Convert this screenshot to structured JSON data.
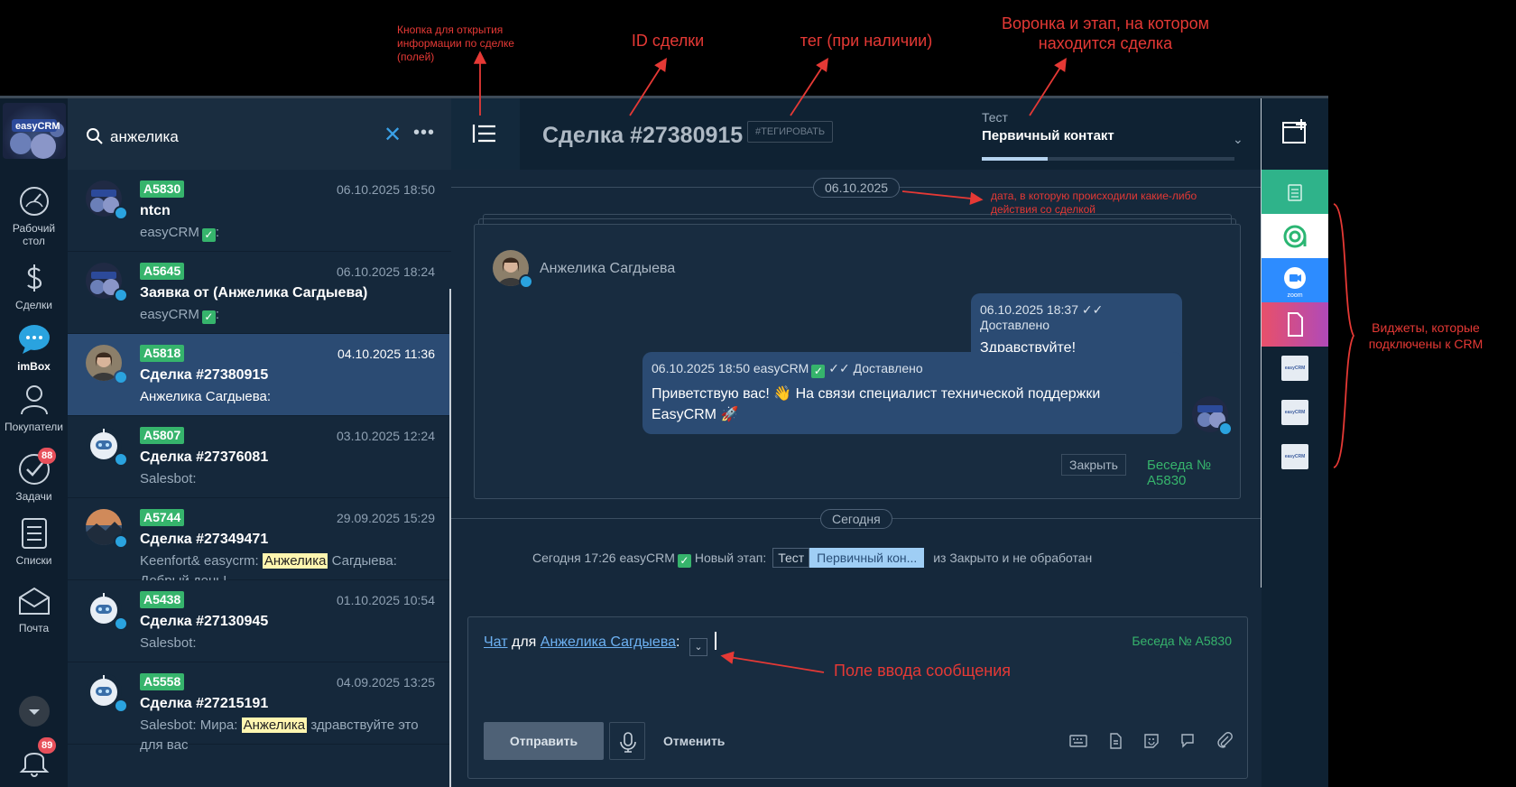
{
  "annotations": {
    "fields_button": "Кнопка для открытия информации по сделке (полей)",
    "deal_id": "ID сделки",
    "tag": "тег (при наличии)",
    "funnel": "Воронка и этап, на котором находится сделка",
    "date": "дата, в которую происходили какие-либо действия со сделкой",
    "widgets": "Виджеты, которые подключены к CRM",
    "input": "Поле ввода сообщения"
  },
  "nav": {
    "logo": "easyCRM",
    "items": [
      {
        "label": "Рабочий стол"
      },
      {
        "label": "Сделки"
      },
      {
        "label": "imBox"
      },
      {
        "label": "Покупатели"
      },
      {
        "label": "Задачи",
        "badge": "88"
      },
      {
        "label": "Списки"
      },
      {
        "label": "Почта"
      },
      {
        "label": "",
        "badge": "89"
      }
    ]
  },
  "search": {
    "query": "анжелика"
  },
  "chats": [
    {
      "code": "A5830",
      "date": "06.10.2025 18:50",
      "title": "ntcn",
      "sub": "easyCRM",
      "sub_suffix": ":"
    },
    {
      "code": "A5645",
      "date": "06.10.2025 18:24",
      "title": "Заявка от (Анжелика Сагдыева)",
      "sub": "easyCRM",
      "sub_suffix": ":"
    },
    {
      "code": "A5818",
      "date": "04.10.2025 11:36",
      "title": "Сделка #27380915",
      "sub": "Анжелика Сагдыева:"
    },
    {
      "code": "A5807",
      "date": "03.10.2025 12:24",
      "title": "Сделка #27376081",
      "sub": "Salesbot:"
    },
    {
      "code": "A5744",
      "date": "29.09.2025 15:29",
      "title": "Сделка #27349471",
      "sub_pre": "Keenfort& easycrm: ",
      "sub_hl": "Анжелика",
      "sub_post": " Сагдыева: Добрый день!"
    },
    {
      "code": "A5438",
      "date": "01.10.2025 10:54",
      "title": "Сделка #27130945",
      "sub": "Salesbot:"
    },
    {
      "code": "A5558",
      "date": "04.09.2025 13:25",
      "title": "Сделка #27215191",
      "sub_pre": "Salesbot: Мира: ",
      "sub_hl": "Анжелика",
      "sub_post": " здравствуйте это для вас"
    }
  ],
  "deal": {
    "title": "Сделка #27380915",
    "tag_button": "#ТЕГИРОВАТЬ",
    "funnel": "Тест",
    "stage": "Первичный контакт",
    "stage_progress": 0.26
  },
  "feed": {
    "date_pill": "06.10.2025",
    "sender": "Анжелика Сагдыева",
    "msg1": {
      "meta_date": "06.10.2025 18:37",
      "status": "Доставлено",
      "text": "Здравствуйте!"
    },
    "msg2": {
      "meta_date": "06.10.2025 18:50 easyCRM",
      "status": "Доставлено",
      "text": "Приветствую вас!  👋  На связи специалист технической поддержки EasyCRM 🚀"
    },
    "close_button": "Закрыть",
    "conversation": "Беседа № A5830",
    "today_pill": "Сегодня",
    "event": {
      "pre": "Сегодня 17:26 easyCRM",
      "label": "Новый этап:",
      "funnel": "Тест",
      "stage": "Первичный кон...",
      "post": "из Закрыто и не обработан"
    }
  },
  "composer": {
    "chat_link": "Чат",
    "for": "для",
    "contact_link": "Анжелика Сагдыева",
    "conversation": "Беседа № A5830",
    "send": "Отправить",
    "cancel": "Отменить"
  },
  "widgets": {
    "logo_text": "easyCRM"
  },
  "colors": {
    "accent_green": "#36b46c",
    "selected_row": "#2b4b73",
    "annotation_red": "#e53935",
    "link_blue": "#6db1f2"
  }
}
